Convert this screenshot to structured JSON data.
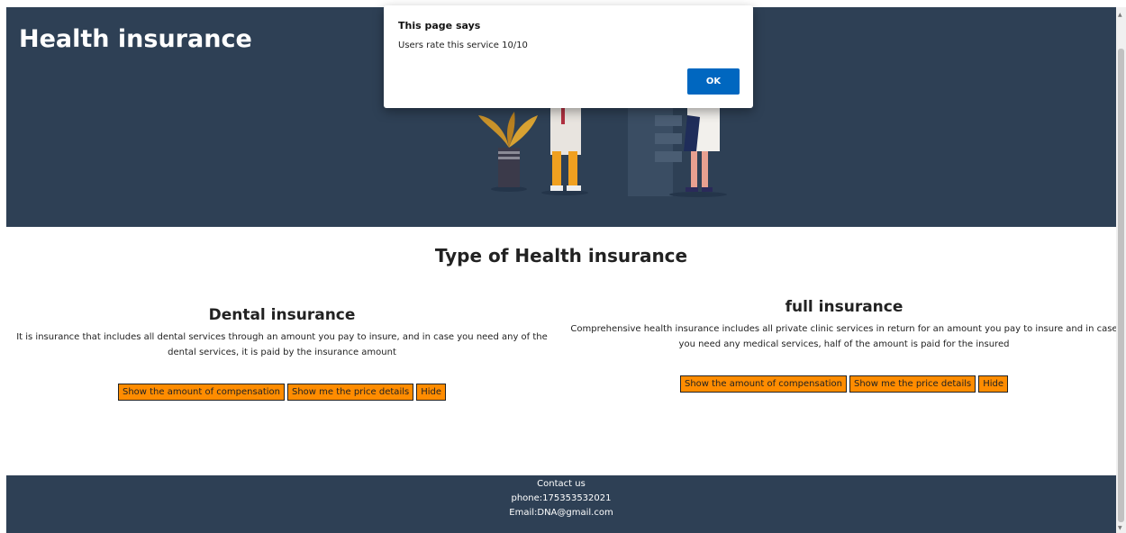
{
  "hero": {
    "title": "Health insurance"
  },
  "section": {
    "title": "Type of Health insurance"
  },
  "cards": [
    {
      "title": "Dental insurance",
      "description": "It is insurance that includes all dental services through an amount you pay to insure, and in case you need any of the dental services, it is paid by the insurance amount",
      "buttons": [
        "Show the amount of compensation",
        "Show me the price details",
        "Hide"
      ]
    },
    {
      "title": "full insurance",
      "description": "Comprehensive health insurance includes all private clinic services in return for an amount you pay to insure and in case you need any medical services, half of the amount is paid for the insured",
      "buttons": [
        "Show the amount of compensation",
        "Show me the price details",
        "Hide"
      ]
    }
  ],
  "footer": {
    "contact": "Contact us",
    "phone": "phone:175353532021",
    "email": "Email:DNA@gmail.com"
  },
  "dialog": {
    "title": "This page says",
    "message": "Users rate this service 10/10",
    "ok_label": "OK"
  },
  "colors": {
    "header_bg": "#2e4055",
    "button_bg": "#ff8c00",
    "dialog_ok": "#0067c0"
  }
}
